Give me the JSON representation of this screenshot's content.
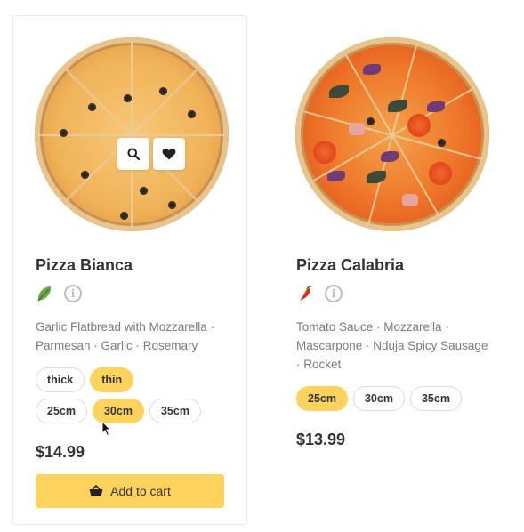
{
  "products": [
    {
      "name": "Pizza Bianca",
      "description": "Garlic Flatbread with Mozzarella · Parmesan · Garlic · Rosemary",
      "badge_icon": "basil-leaf-icon",
      "crust_options": [
        "thick",
        "thin"
      ],
      "crust_selected": "thin",
      "size_options": [
        "25cm",
        "30cm",
        "35cm"
      ],
      "size_selected": "30cm",
      "price": "$14.99",
      "add_to_cart_label": "Add to cart",
      "quick_actions": [
        "search-icon",
        "heart-icon"
      ]
    },
    {
      "name": "Pizza Calabria",
      "description": "Tomato Sauce · Mozzarella · Mascarpone · Nduja Spicy Sausage · Rocket",
      "badge_icon": "chili-pepper-icon",
      "size_options": [
        "25cm",
        "30cm",
        "35cm"
      ],
      "size_selected": "25cm",
      "price": "$13.99"
    }
  ],
  "colors": {
    "accent": "#fdd35e",
    "text": "#333333",
    "muted": "#7a7a7a",
    "border": "#dcdcdc"
  }
}
